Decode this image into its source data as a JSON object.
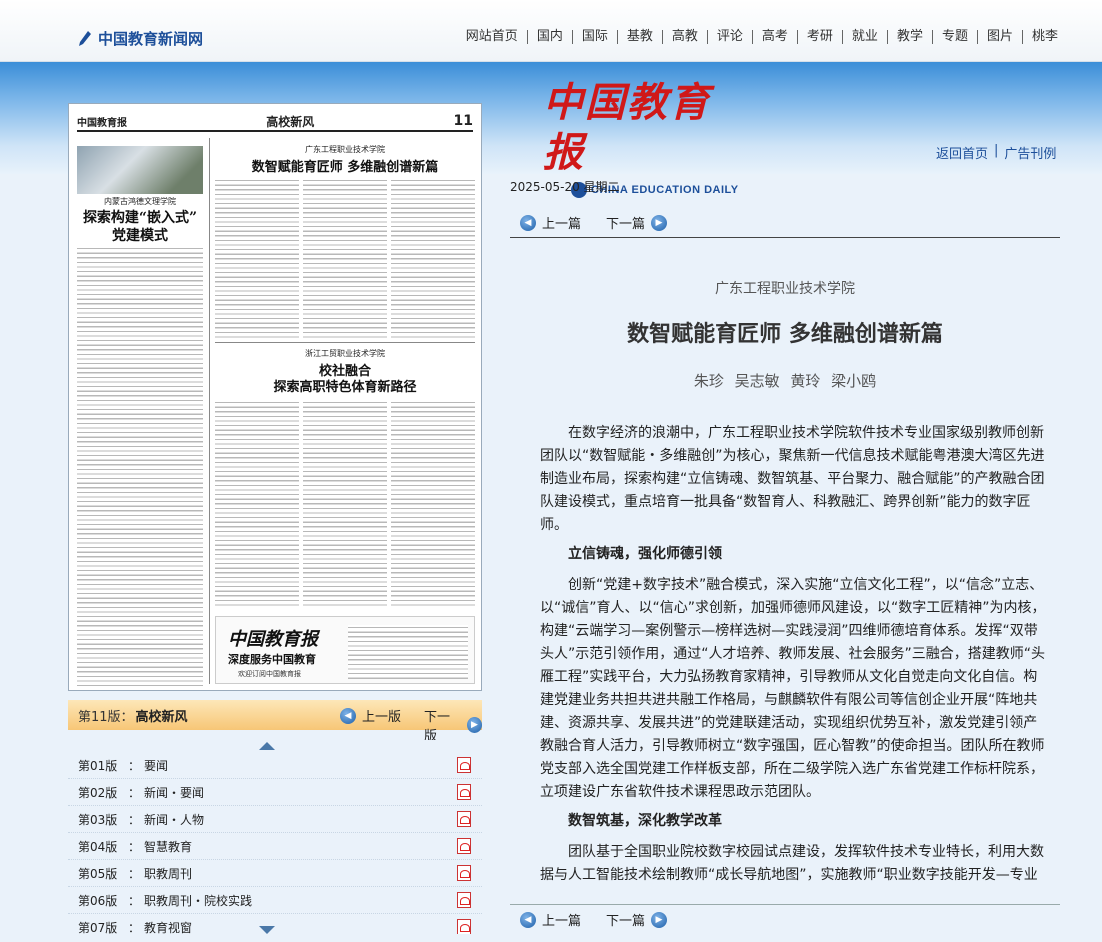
{
  "site": {
    "logo_text": "中国教育新闻网",
    "nav": [
      "网站首页",
      "国内",
      "国际",
      "基教",
      "高教",
      "评论",
      "高考",
      "考研",
      "就业",
      "教学",
      "专题",
      "图片",
      "桃李"
    ]
  },
  "masthead": {
    "title": "中国教育报",
    "subtitle": "CHINA EDUCATION DAILY",
    "links": [
      "返回首页",
      "广告刊例"
    ]
  },
  "newspaper_page": {
    "logo": "中国教育报",
    "section": "高校新风",
    "page_num": "11",
    "left_school": "内蒙古鸿德文理学院",
    "left_title_1": "探索构建“嵌入式”",
    "left_title_2": "党建模式",
    "right_school_1": "广东工程职业技术学院",
    "right_title_1": "数智赋能育匠师  多维融创谱新篇",
    "right_school_2": "浙江工贸职业技术学院",
    "right_title_2a": "校社融合",
    "right_title_2b": "探索高职特色体育新路径",
    "ad_logo": "中国教育报",
    "ad_slogan": "深度服务中国教育",
    "ad_small": "欢迎订阅中国教育报"
  },
  "edition_bar": {
    "label": "第11版：",
    "name": "高校新风",
    "prev": "上一版",
    "next": "下一版"
  },
  "page_list": [
    {
      "num": "第01版",
      "name": "要闻"
    },
    {
      "num": "第02版",
      "name": "新闻・要闻"
    },
    {
      "num": "第03版",
      "name": "新闻・人物"
    },
    {
      "num": "第04版",
      "name": "智慧教育"
    },
    {
      "num": "第05版",
      "name": "职教周刊"
    },
    {
      "num": "第06版",
      "name": "职教周刊・院校实践"
    },
    {
      "num": "第07版",
      "name": "教育视窗"
    }
  ],
  "article": {
    "date": "2025-05-20  星期二",
    "prev": "上一篇",
    "next": "下一篇",
    "kicker": "广东工程职业技术学院",
    "title": "数智赋能育匠师  多维融创谱新篇",
    "authors": "朱珍 吴志敏 黄玲 梁小鸥",
    "p1": "在数字经济的浪潮中，广东工程职业技术学院软件技术专业国家级别教师创新团队以“数智赋能・多维融创”为核心，聚焦新一代信息技术赋能粤港澳大湾区先进制造业布局，探索构建“立信铸魂、数智筑基、平台聚力、融合赋能”的产教融合团队建设模式，重点培育一批具备“数智育人、科教融汇、跨界创新”能力的数字匠师。",
    "h1": "立信铸魂，强化师德引领",
    "p2": "创新“党建+数字技术”融合模式，深入实施“立信文化工程”，以“信念”立志、以“诚信”育人、以“信心”求创新，加强师德师风建设，以“数字工匠精神”为内核，构建“云端学习—案例警示—榜样选树—实践浸润”四维师德培育体系。发挥“双带头人”示范引领作用，通过“人才培养、教师发展、社会服务”三融合，搭建教师“头雁工程”实践平台，大力弘扬教育家精神，引导教师从文化自觉走向文化自信。构建党建业务共担共进共融工作格局，与麒麟软件有限公司等信创企业开展“阵地共建、资源共享、发展共进”的党建联建活动，实现组织优势互补，激发党建引领产教融合育人活力，引导教师树立“数字强国，匠心智教”的使命担当。团队所在教师党支部入选全国党建工作样板支部，所在二级学院入选广东省党建工作标杆院系，立项建设广东省软件技术课程思政示范团队。",
    "h2": "数智筑基，深化教学改革",
    "p3": "团队基于全国职业院校数字校园试点建设，发挥软件技术专业特长，利用大数据与人工智能技术绘制教师“成长导航地图”，实施教师“职业数字技能开发—专业数字转型建设—教学数字技术应用”三维数字能力提升计划。"
  }
}
